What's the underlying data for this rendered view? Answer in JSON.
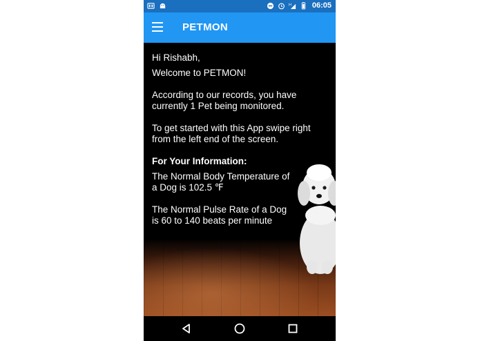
{
  "status_bar": {
    "time": "06:05",
    "left_icons": [
      "sim-icon",
      "android-icon"
    ],
    "right_icons": [
      "do-not-disturb-icon",
      "alarm-icon",
      "network-h-icon",
      "battery-icon"
    ]
  },
  "app_bar": {
    "title": "PETMON",
    "menu_icon": "hamburger-menu-icon",
    "background": "#2196f3"
  },
  "content": {
    "greeting": "Hi Rishabh,",
    "welcome": "Welcome to PETMON!",
    "records": "According to our records, you have currently 1 Pet being monitored.",
    "instructions": "To get started with this App swipe right from the left end of the screen.",
    "fyi_heading": "For Your Information:",
    "temperature_info": "The Normal Body Temperature of a Dog is 102.5 ℉",
    "pulse_info": "The Normal Pulse Rate of a Dog is 60 to 140 beats per minute"
  },
  "nav_bar": {
    "back_icon": "back-triangle-icon",
    "home_icon": "home-circle-icon",
    "recents_icon": "recents-square-icon"
  }
}
